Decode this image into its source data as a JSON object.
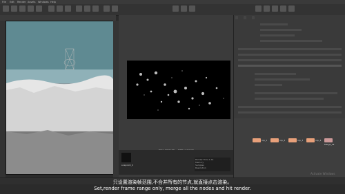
{
  "menubar": {
    "items": [
      "File",
      "Edit",
      "Render",
      "Assets",
      "Windows",
      "Help"
    ]
  },
  "render_view": {
    "status": "Time: 00:01:00 — 100% complete",
    "thumb_label": "snapshot_0",
    "info_lines": [
      "Render Time 1.0s",
      "Memory",
      "Samples",
      "Resolution"
    ]
  },
  "network": {
    "nodes": [
      "rop_1",
      "rop_2",
      "rop_3",
      "rop_4"
    ],
    "merge_label": "Merge_all"
  },
  "captions": {
    "chinese": "只设置渲染帧范围,不合并所有的节点,就直接点击渲染。",
    "english": "Set,render frame range only, merge all the nodes and hit render."
  },
  "watermark": "Activate Windows",
  "colors": {
    "node": "#e8a07a",
    "background": "#2b2b2b",
    "sky": "#5f8a92"
  }
}
